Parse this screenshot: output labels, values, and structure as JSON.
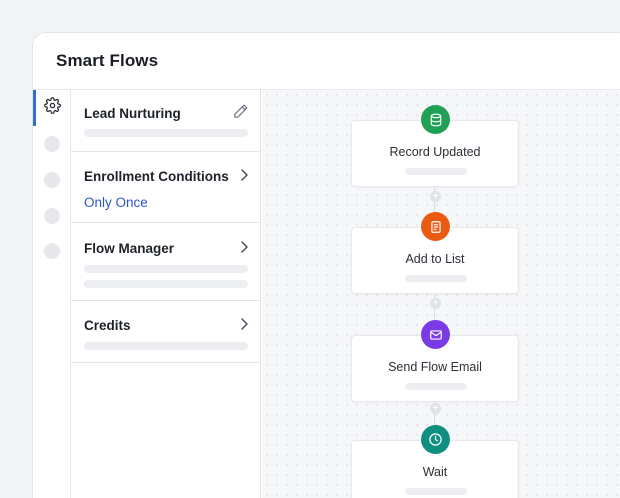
{
  "app": {
    "title": "Smart Flows"
  },
  "sidebar": {
    "active_icon": "gear-icon",
    "placeholder_count": 4
  },
  "panel": {
    "cards": [
      {
        "title": "Lead Nurturing",
        "action_icon": "pencil-icon"
      },
      {
        "title": "Enrollment Conditions",
        "value": "Only Once",
        "action_icon": "chevron-right-icon"
      },
      {
        "title": "Flow Manager",
        "action_icon": "chevron-right-icon"
      },
      {
        "title": "Credits",
        "action_icon": "chevron-right-icon"
      }
    ]
  },
  "flow": {
    "steps": [
      {
        "label": "Record Updated",
        "icon": "database-icon",
        "color": "#1fa055"
      },
      {
        "label": "Add to List",
        "icon": "list-document-icon",
        "color": "#ea5b12"
      },
      {
        "label": "Send Flow Email",
        "icon": "envelope-icon",
        "color": "#7a3be6"
      },
      {
        "label": "Wait",
        "icon": "clock-icon",
        "color": "#0f8f82"
      }
    ]
  },
  "colors": {
    "accent": "#2f6fd6",
    "link": "#2d56c9"
  }
}
